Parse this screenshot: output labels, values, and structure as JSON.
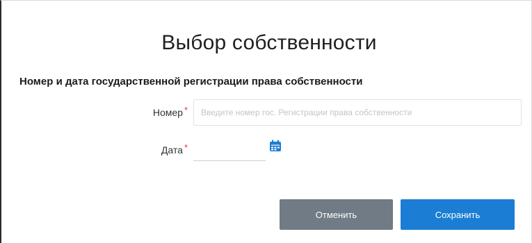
{
  "dialog": {
    "title": "Выбор собственности",
    "section_title": "Номер и дата государственной регистрации права собственности"
  },
  "form": {
    "number_label": "Номер",
    "number_placeholder": "Введите номер гос. Регистрации права собственности",
    "number_value": "",
    "date_label": "Дата",
    "date_value": "",
    "required_mark": "*"
  },
  "buttons": {
    "cancel_label": "Отменить",
    "save_label": "Сохранить"
  },
  "colors": {
    "cancel_bg": "#707b85",
    "save_bg": "#1b7ed4",
    "required": "#e53935",
    "calendar_icon": "#1b7ed4"
  }
}
